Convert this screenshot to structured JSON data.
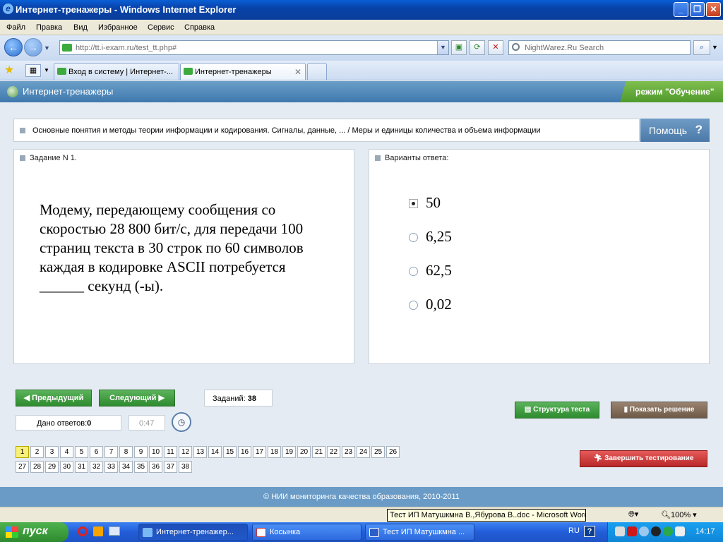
{
  "window": {
    "title": "Интернет-тренажеры - Windows Internet Explorer"
  },
  "menu": [
    "Файл",
    "Правка",
    "Вид",
    "Избранное",
    "Сервис",
    "Справка"
  ],
  "address": {
    "url": "http://tt.i-exam.ru/test_tt.php#"
  },
  "search": {
    "placeholder": "NightWarez.Ru Search"
  },
  "tabs": [
    {
      "label": "Вход в систему | Интернет-..."
    },
    {
      "label": "Интернет-тренажеры"
    }
  ],
  "header": {
    "title": "Интернет-тренажеры",
    "mode": "режим \"Обучение\""
  },
  "topic": {
    "text": "Основные понятия и методы теории информации и кодирования. Сигналы, данные, ... / Меры и единицы количества и объема информации"
  },
  "help": {
    "label": "Помощь",
    "icon": "?"
  },
  "task": {
    "header": "Задание N 1.",
    "text": "Модему, передающему сообщения со скоростью 28 800 бит/с, для передачи 100 страниц текста в 30 строк по 60 символов каждая в кодировке ASCII потребуется ______ секунд (-ы)."
  },
  "answers": {
    "header": "Варианты ответа:",
    "options": [
      "50",
      "6,25",
      "62,5",
      "0,02"
    ],
    "selected_index": 0
  },
  "nav": {
    "prev": "Предыдущий",
    "next": "Следующий",
    "tasks_label": "Заданий:",
    "tasks_count": "38"
  },
  "answers_given": {
    "label": "Дано ответов:",
    "value": "0"
  },
  "timer": "0:47",
  "buttons": {
    "structure": "Структура теста",
    "show_solution": "Показать решение",
    "finish": "Завершить тестирование"
  },
  "question_numbers": [
    "1",
    "2",
    "3",
    "4",
    "5",
    "6",
    "7",
    "8",
    "9",
    "10",
    "11",
    "12",
    "13",
    "14",
    "15",
    "16",
    "17",
    "18",
    "19",
    "20",
    "21",
    "22",
    "23",
    "24",
    "25",
    "26",
    "27",
    "28",
    "29",
    "30",
    "31",
    "32",
    "33",
    "34",
    "35",
    "36",
    "37",
    "38"
  ],
  "current_question": "1",
  "footer": "© НИИ мониторинга качества образования, 2010-2011",
  "statusbar": {
    "zoom": "100%",
    "tooltip": "Тест ИП Матушкмна В.,Ябурова В..doc - Microsoft Word"
  },
  "taskbar": {
    "start": "пуск",
    "tasks": [
      "Интернет-тренажер...",
      "Косынка",
      "Тест ИП Матушкмна ..."
    ],
    "lang": "RU",
    "time": "14:17"
  }
}
